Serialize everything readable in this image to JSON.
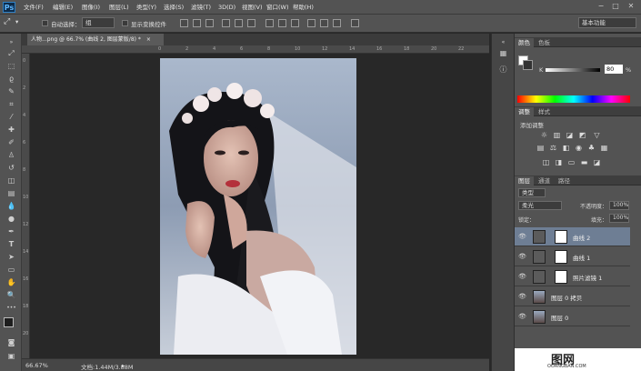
{
  "app": {
    "logo": "Ps",
    "menus": [
      "文件(F)",
      "编辑(E)",
      "图像(I)",
      "图层(L)",
      "类型(Y)",
      "选择(S)",
      "滤镜(T)",
      "3D(D)",
      "视图(V)",
      "窗口(W)",
      "帮助(H)"
    ],
    "window_buttons": [
      "−",
      "□",
      "✕"
    ]
  },
  "options": {
    "auto_select_label": "自动选择：",
    "auto_select_value": "组",
    "show_transform_label": "显示变换控件",
    "workspace": "基本功能"
  },
  "document": {
    "tab_label": "人物...png @ 66.7% (曲线 2, 图层蒙版/8) *",
    "close": "×",
    "zoom": "66.67%",
    "doc_info": "文档:1.44M/3.88M"
  },
  "rulers": {
    "top": [
      "0",
      "2",
      "4",
      "6",
      "8",
      "10",
      "12",
      "14",
      "16",
      "18",
      "20",
      "22",
      "24",
      "26",
      "28",
      "30",
      "32"
    ],
    "left": [
      "0",
      "2",
      "4",
      "6",
      "8",
      "10",
      "12",
      "14",
      "16",
      "18",
      "20"
    ]
  },
  "color_panel": {
    "tabs": [
      "颜色",
      "色板"
    ],
    "k_label": "K",
    "k_value": "80",
    "percent": "%"
  },
  "adjust_panel": {
    "tabs": [
      "调整",
      "样式"
    ],
    "title": "添加调整"
  },
  "layers_panel": {
    "tabs": [
      "图层",
      "通道",
      "路径"
    ],
    "kind_label": "类型",
    "blend_mode": "柔光",
    "opacity_label": "不透明度：",
    "opacity": "100%",
    "lock_label": "锁定：",
    "fill_label": "填充：",
    "fill": "100%",
    "layers": [
      {
        "name": "曲线 2",
        "kind": "adjust",
        "selected": true
      },
      {
        "name": "曲线 1",
        "kind": "adjust",
        "selected": false
      },
      {
        "name": "照片滤镜 1",
        "kind": "adjust",
        "selected": false
      },
      {
        "name": "图层 0 拷贝",
        "kind": "photo",
        "selected": false
      },
      {
        "name": "图层 0",
        "kind": "photo",
        "selected": false
      }
    ]
  },
  "watermark": {
    "text": "图网",
    "url": "OOANGBAN.COM"
  },
  "colors": {
    "menubar": "#535353",
    "canvas": "#282828",
    "panel": "#535353",
    "selected_layer": "#6e7e94"
  }
}
